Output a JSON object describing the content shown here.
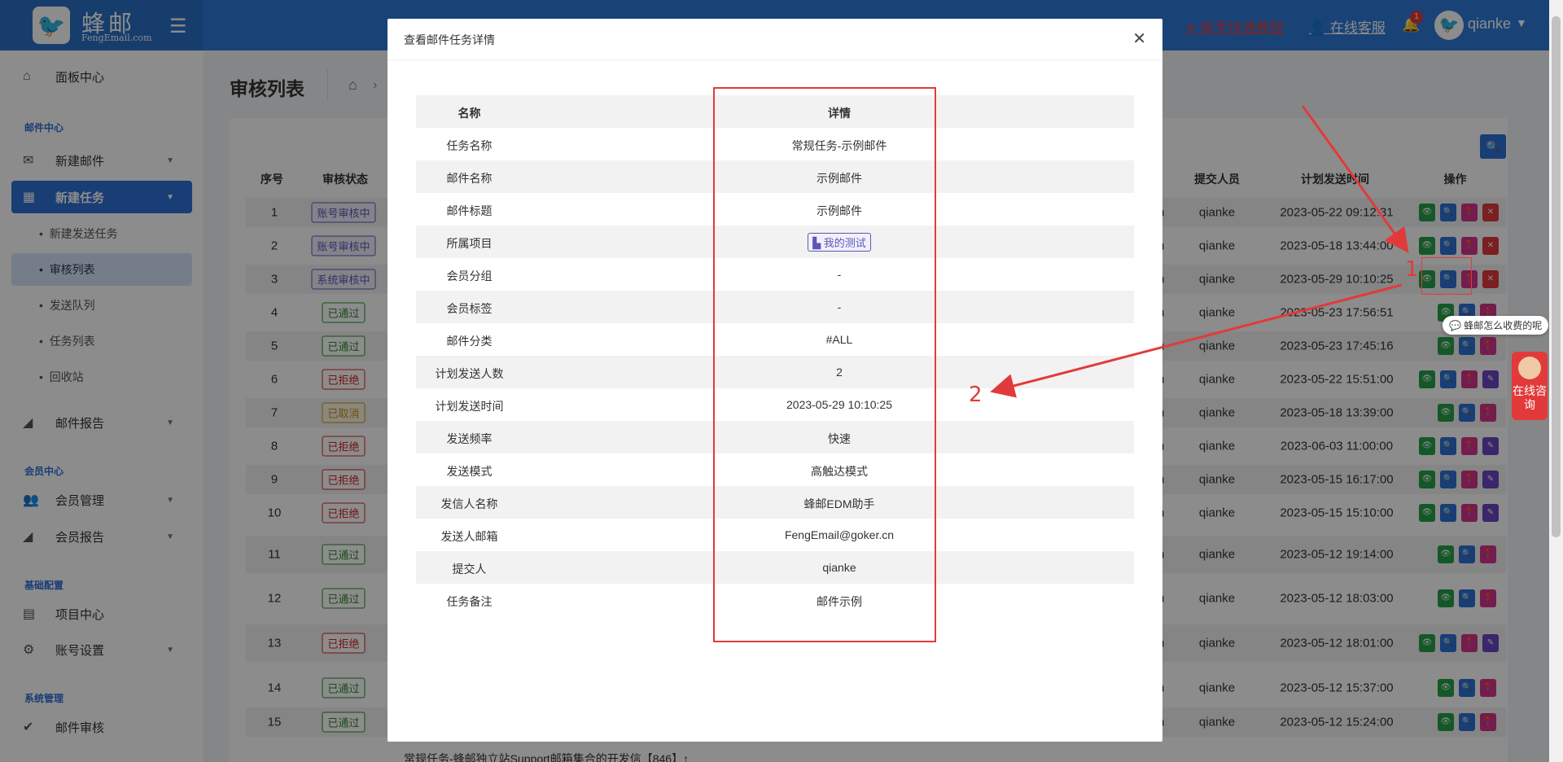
{
  "header": {
    "brand_name": "蜂邮",
    "brand_sub": "FengEmail.com",
    "guide_link": "新手快速教程",
    "service_link": "在线客服",
    "bell_count": "1",
    "user_name": "qianke"
  },
  "sidebar": {
    "items": [
      {
        "label": "面板中心"
      },
      {
        "section": "邮件中心"
      },
      {
        "label": "新建邮件"
      },
      {
        "label": "新建任务"
      },
      {
        "label": "新建发送任务"
      },
      {
        "label": "审核列表"
      },
      {
        "label": "发送队列"
      },
      {
        "label": "任务列表"
      },
      {
        "label": "回收站"
      },
      {
        "label": "邮件报告"
      },
      {
        "section": "会员中心"
      },
      {
        "label": "会员管理"
      },
      {
        "label": "会员报告"
      },
      {
        "section": "基础配置"
      },
      {
        "label": "项目中心"
      },
      {
        "label": "账号设置"
      },
      {
        "section": "系统管理"
      },
      {
        "label": "邮件审核"
      }
    ]
  },
  "page": {
    "title": "审核列表"
  },
  "table": {
    "headers": {
      "no": "序号",
      "status": "审核状态",
      "submitter": "提交人员",
      "time": "计划发送时间",
      "ops": "操作"
    },
    "rows": [
      {
        "no": "1",
        "status": "账号审核中",
        "kind": "review",
        "submitter": "qianke",
        "time": "2023-05-22 09:12:31",
        "ops": [
          "eye",
          "search",
          "loc",
          "del"
        ]
      },
      {
        "no": "2",
        "status": "账号审核中",
        "kind": "review",
        "submitter": "qianke",
        "time": "2023-05-18 13:44:00",
        "ops": [
          "eye",
          "search",
          "loc",
          "del"
        ]
      },
      {
        "no": "3",
        "status": "系统审核中",
        "kind": "review",
        "submitter": "qianke",
        "time": "2023-05-29 10:10:25",
        "ops": [
          "eye",
          "search",
          "loc",
          "del"
        ]
      },
      {
        "no": "4",
        "status": "已通过",
        "kind": "pass",
        "submitter": "qianke",
        "time": "2023-05-23 17:56:51",
        "ops": [
          "eye",
          "search",
          "loc"
        ]
      },
      {
        "no": "5",
        "status": "已通过",
        "kind": "pass",
        "submitter": "qianke",
        "time": "2023-05-23 17:45:16",
        "ops": [
          "eye",
          "search",
          "loc"
        ]
      },
      {
        "no": "6",
        "status": "已拒绝",
        "kind": "reject",
        "submitter": "qianke",
        "time": "2023-05-22 15:51:00",
        "ops": [
          "eye",
          "search",
          "loc",
          "edit"
        ]
      },
      {
        "no": "7",
        "status": "已取消",
        "kind": "cancel",
        "submitter": "qianke",
        "time": "2023-05-18 13:39:00",
        "ops": [
          "eye",
          "search",
          "loc"
        ]
      },
      {
        "no": "8",
        "status": "已拒绝",
        "kind": "reject",
        "submitter": "qianke",
        "time": "2023-06-03 11:00:00",
        "ops": [
          "eye",
          "search",
          "loc",
          "edit"
        ]
      },
      {
        "no": "9",
        "status": "已拒绝",
        "kind": "reject",
        "submitter": "qianke",
        "time": "2023-05-15 16:17:00",
        "ops": [
          "eye",
          "search",
          "loc",
          "edit"
        ]
      },
      {
        "no": "10",
        "status": "已拒绝",
        "kind": "reject",
        "submitter": "qianke",
        "time": "2023-05-15 15:10:00",
        "ops": [
          "eye",
          "search",
          "loc",
          "edit"
        ]
      },
      {
        "no": "11",
        "status": "已通过",
        "kind": "pass",
        "submitter": "qianke",
        "time": "2023-05-12 19:14:00",
        "ops": [
          "eye",
          "search",
          "loc"
        ]
      },
      {
        "no": "12",
        "status": "已通过",
        "kind": "pass",
        "submitter": "qianke",
        "time": "2023-05-12 18:03:00",
        "ops": [
          "eye",
          "search",
          "loc"
        ]
      },
      {
        "no": "13",
        "status": "已拒绝",
        "kind": "reject",
        "submitter": "qianke",
        "time": "2023-05-12 18:01:00",
        "ops": [
          "eye",
          "search",
          "loc",
          "edit"
        ]
      },
      {
        "no": "14",
        "status": "已通过",
        "kind": "pass",
        "submitter": "qianke",
        "time": "2023-05-12 15:37:00",
        "ops": [
          "eye",
          "search",
          "loc"
        ]
      },
      {
        "no": "15",
        "status": "已通过",
        "kind": "pass",
        "submitter": "qianke",
        "time": "2023-05-12 15:24:00",
        "ops": [
          "eye",
          "search",
          "loc"
        ]
      }
    ],
    "bottom_task": "常规任务-蜂邮独立站Support邮箱集合的开发信【846】↑"
  },
  "modal": {
    "title": "查看邮件任务详情",
    "col_name": "名称",
    "col_detail": "详情",
    "rows": [
      {
        "k": "任务名称",
        "v": "常规任务-示例邮件"
      },
      {
        "k": "邮件名称",
        "v": "示例邮件"
      },
      {
        "k": "邮件标题",
        "v": "示例邮件"
      },
      {
        "k": "所属项目",
        "v": "我的测试",
        "tag": true
      },
      {
        "k": "会员分组",
        "v": "-"
      },
      {
        "k": "会员标签",
        "v": "-"
      },
      {
        "k": "邮件分类",
        "v": "#ALL"
      },
      {
        "k": "计划发送人数",
        "v": "2"
      },
      {
        "k": "计划发送时间",
        "v": "2023-05-29 10:10:25"
      },
      {
        "k": "发送频率",
        "v": "快速"
      },
      {
        "k": "发送模式",
        "v": "高触达模式"
      },
      {
        "k": "发信人名称",
        "v": "蜂邮EDM助手"
      },
      {
        "k": "发送人邮箱",
        "v": "FengEmail@goker.cn"
      },
      {
        "k": "提交人",
        "v": "qianke"
      },
      {
        "k": "任务备注",
        "v": "邮件示例"
      }
    ]
  },
  "annotations": {
    "one": "1",
    "two": "2"
  },
  "widgets": {
    "chat_bubble": "蜂邮怎么收费的呢",
    "consult": "在线咨询"
  },
  "colors": {
    "primary": "#2f7bd9",
    "annotation": "#e23a3a"
  }
}
